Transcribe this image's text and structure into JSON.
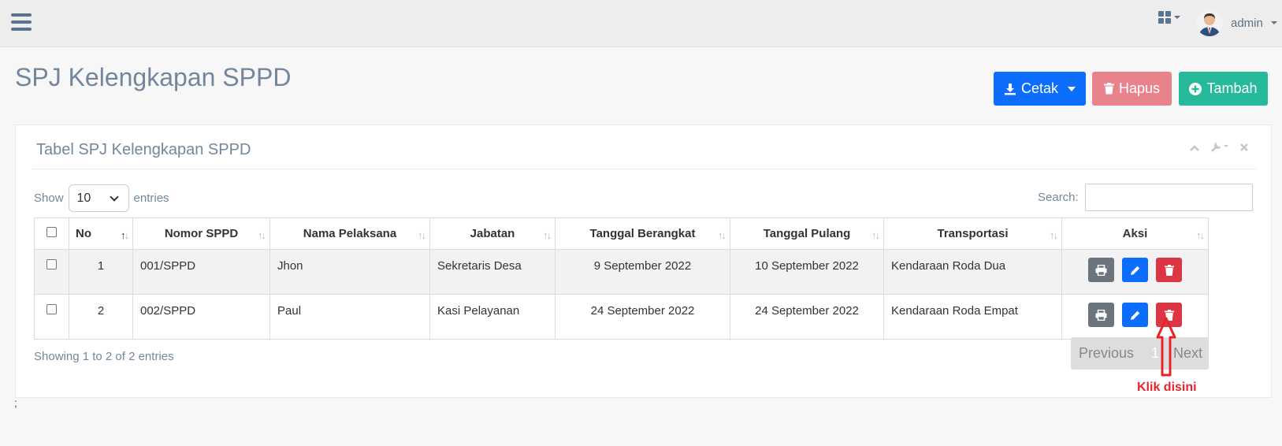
{
  "topbar": {
    "menu_icon": "hamburger-icon",
    "apps_icon": "grid-icon",
    "user_name": "admin"
  },
  "page": {
    "title": "SPJ Kelengkapan SPPD"
  },
  "toolbar": {
    "cetak_label": "Cetak",
    "hapus_label": "Hapus",
    "tambah_label": "Tambah",
    "colors": {
      "cetak": "#0d6efd",
      "hapus": "#e9838b",
      "tambah": "#26b99a"
    }
  },
  "panel": {
    "title": "Tabel SPJ Kelengkapan SPPD",
    "tools": [
      "chevron-up-icon",
      "wrench-icon",
      "close-icon"
    ]
  },
  "controls": {
    "show_label": "Show",
    "page_size": "10",
    "entries_label": "entries",
    "search_label": "Search:",
    "search_value": ""
  },
  "table": {
    "columns": [
      "No",
      "Nomor SPPD",
      "Nama Pelaksana",
      "Jabatan",
      "Tanggal Berangkat",
      "Tanggal Pulang",
      "Transportasi",
      "Aksi"
    ],
    "rows": [
      {
        "no": "1",
        "nomor": "001/SPPD",
        "nama": "Jhon",
        "jabatan": "Sekretaris Desa",
        "berangkat": "9 September 2022",
        "pulang": "10 September 2022",
        "transportasi": "Kendaraan Roda Dua"
      },
      {
        "no": "2",
        "nomor": "002/SPPD",
        "nama": "Paul",
        "jabatan": "Kasi Pelayanan",
        "berangkat": "24 September 2022",
        "pulang": "24 September 2022",
        "transportasi": "Kendaraan Roda Empat"
      }
    ]
  },
  "footer": {
    "info": "Showing 1 to 2 of 2 entries",
    "previous": "Previous",
    "page": "1",
    "next": "Next"
  },
  "annotation": {
    "text": "Klik disini",
    "color": "#e8232a"
  },
  "misc": {
    "semicolon": ";"
  }
}
